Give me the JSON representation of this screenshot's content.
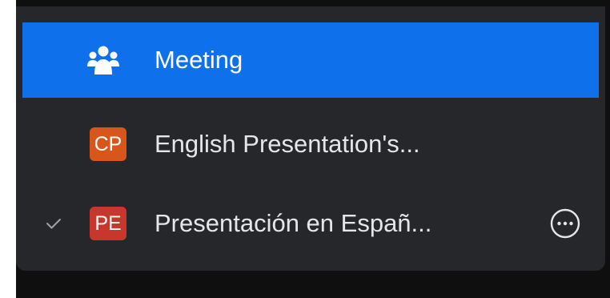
{
  "menu": {
    "items": [
      {
        "label": "Meeting",
        "icon": "participants-icon",
        "active": true,
        "checked": false
      },
      {
        "label": "English Presentation's...",
        "avatar_text": "CP",
        "avatar_color": "#d9561a",
        "active": false,
        "checked": false
      },
      {
        "label": "Presentación en Españ...",
        "avatar_text": "PE",
        "avatar_color": "#c8372b",
        "active": false,
        "checked": true,
        "more_icon": "more-options-icon"
      }
    ]
  },
  "colors": {
    "menu_bg": "#26272b",
    "active_bg": "#0e71eb",
    "text": "#e6e6e8"
  }
}
